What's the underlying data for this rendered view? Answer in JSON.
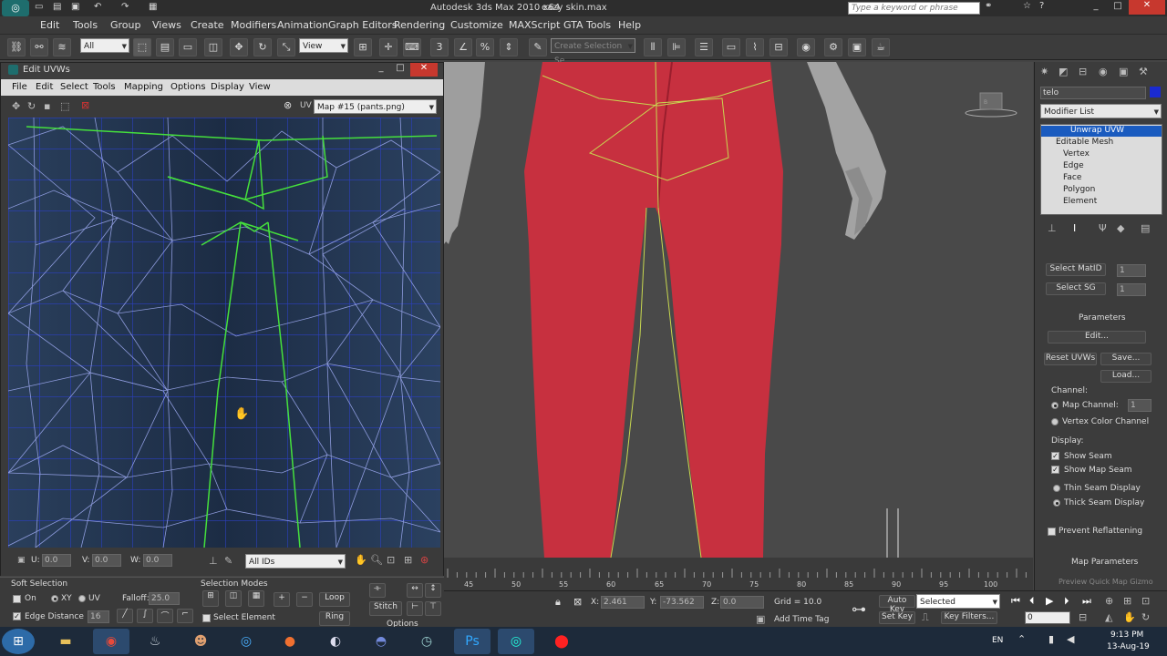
{
  "titlebar": {
    "app_title": "Autodesk 3ds Max 2010 x64",
    "file_name": "eazy skin.max",
    "search_placeholder": "Type a keyword or phrase"
  },
  "menu": [
    "Edit",
    "Tools",
    "Group",
    "Views",
    "Create",
    "Modifiers",
    "Animation",
    "Graph Editors",
    "Rendering",
    "Customize",
    "MAXScript",
    "GTA Tools",
    "Help"
  ],
  "toolbar": {
    "filter_value": "All",
    "view_value": "View",
    "selection_set_placeholder": "Create Selection Se"
  },
  "uvw": {
    "title": "Edit UVWs",
    "menu": [
      "File",
      "Edit",
      "Select",
      "Tools",
      "Mapping",
      "Options",
      "Display",
      "View"
    ],
    "uv_label": "UV",
    "map_value": "Map #15 (pants.png)",
    "u_label": "U:",
    "u_value": "0.0",
    "v_label": "V:",
    "v_value": "0.0",
    "w_label": "W:",
    "w_value": "0.0",
    "ids_value": "All IDs"
  },
  "soft_selection": {
    "title": "Soft Selection",
    "on_label": "On",
    "xy_label": "XY",
    "uv_label": "UV",
    "falloff_label": "Falloff:",
    "falloff_value": "25.0",
    "edge_distance_label": "Edge Distance",
    "edge_distance_value": "16",
    "selection_modes_title": "Selection Modes",
    "loop_label": "Loop",
    "ring_label": "Ring",
    "select_element_label": "Select Element",
    "stitch_label": "Stitch",
    "options_label": "Options"
  },
  "cmdpanel": {
    "object_name": "telo",
    "modifier_list": "Modifier List",
    "stack": [
      "Unwrap UVW",
      "Editable Mesh",
      "Vertex",
      "Edge",
      "Face",
      "Polygon",
      "Element"
    ],
    "select_matid": "Select MatID",
    "matid_value": "1",
    "select_sg": "Select SG",
    "sg_value": "1",
    "parameters_title": "Parameters",
    "edit_button": "Edit...",
    "reset_uvws": "Reset UVWs",
    "save_button": "Save...",
    "load_button": "Load...",
    "channel_label": "Channel:",
    "map_channel_label": "Map Channel:",
    "map_channel_value": "1",
    "vertex_color_channel": "Vertex Color Channel",
    "display_label": "Display:",
    "show_seam": "Show Seam",
    "show_map_seam": "Show Map Seam",
    "thin_seam": "Thin Seam Display",
    "thick_seam": "Thick Seam Display",
    "prevent_reflattening": "Prevent Reflattening",
    "map_parameters": "Map Parameters",
    "preview_quick_map": "Preview Quick Map Gizmo"
  },
  "timeline": {
    "ticks": [
      "45",
      "50",
      "55",
      "60",
      "65",
      "70",
      "75",
      "80",
      "85",
      "90",
      "95",
      "100"
    ]
  },
  "status": {
    "x_label": "X:",
    "x_value": "2.461",
    "y_label": "Y:",
    "y_value": "-73.562",
    "z_label": "Z:",
    "z_value": "0.0",
    "grid": "Grid = 10.0",
    "add_time_tag": "Add Time Tag",
    "auto_key": "Auto Key",
    "set_key": "Set Key",
    "selected_value": "Selected",
    "key_filters": "Key Filters...",
    "frame_value": "0"
  },
  "taskbar": {
    "lang": "EN",
    "time": "9:13 PM",
    "date": "13-Aug-19"
  },
  "colors": {
    "uv_bg": "#1f3350",
    "seam": "#3ee03a",
    "wire": "#9aa8ff",
    "pants": "#c8303e",
    "accent": "#1a5bbf"
  }
}
